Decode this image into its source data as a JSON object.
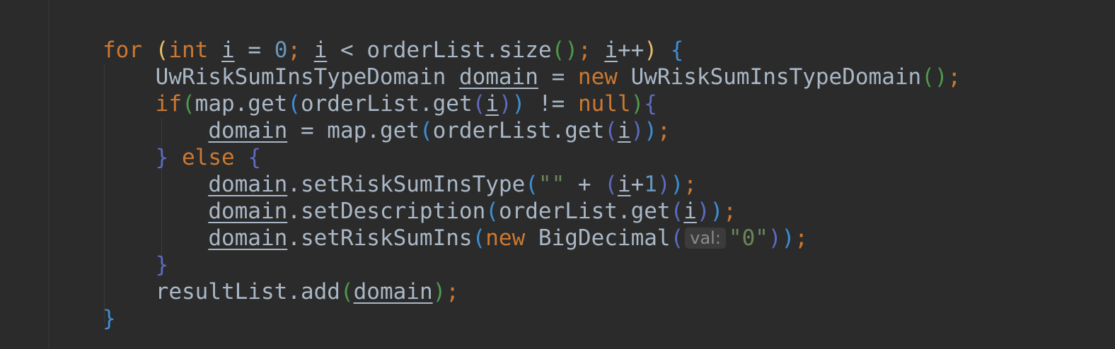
{
  "editor": {
    "line1": {
      "for": "for",
      "int": "int",
      "i1": "i",
      "eq": " = ",
      "zero": "0",
      "i2": "i",
      "lt": " < orderList.size",
      "i3": "i",
      "inc": "++"
    },
    "line2": {
      "type": "UwRiskSumInsTypeDomain",
      "domain": "domain",
      "eq": " = ",
      "new": "new",
      "ctor": " UwRiskSumInsTypeDomain"
    },
    "line3": {
      "if": "if",
      "call": "map.get",
      "arg": "orderList.get",
      "i": "i",
      "neq": " != ",
      "null": "null"
    },
    "line4": {
      "domain": "domain",
      "assign": " = map.get",
      "arg": "orderList.get",
      "i": "i"
    },
    "line5": {
      "else": "else"
    },
    "line6": {
      "domain": "domain",
      "method": ".setRiskSumInsType",
      "str": "\"\"",
      "plus": " + ",
      "i": "i",
      "op": "+",
      "one": "1"
    },
    "line7": {
      "domain": "domain",
      "method": ".setDescription",
      "arg": "orderList.get",
      "i": "i"
    },
    "line8": {
      "domain": "domain",
      "method": ".setRiskSumIns",
      "new": "new",
      "cls": " BigDecimal",
      "hint": "val:",
      "str": "\"0\""
    },
    "line10": {
      "call": "resultList.add",
      "domain": "domain"
    }
  }
}
